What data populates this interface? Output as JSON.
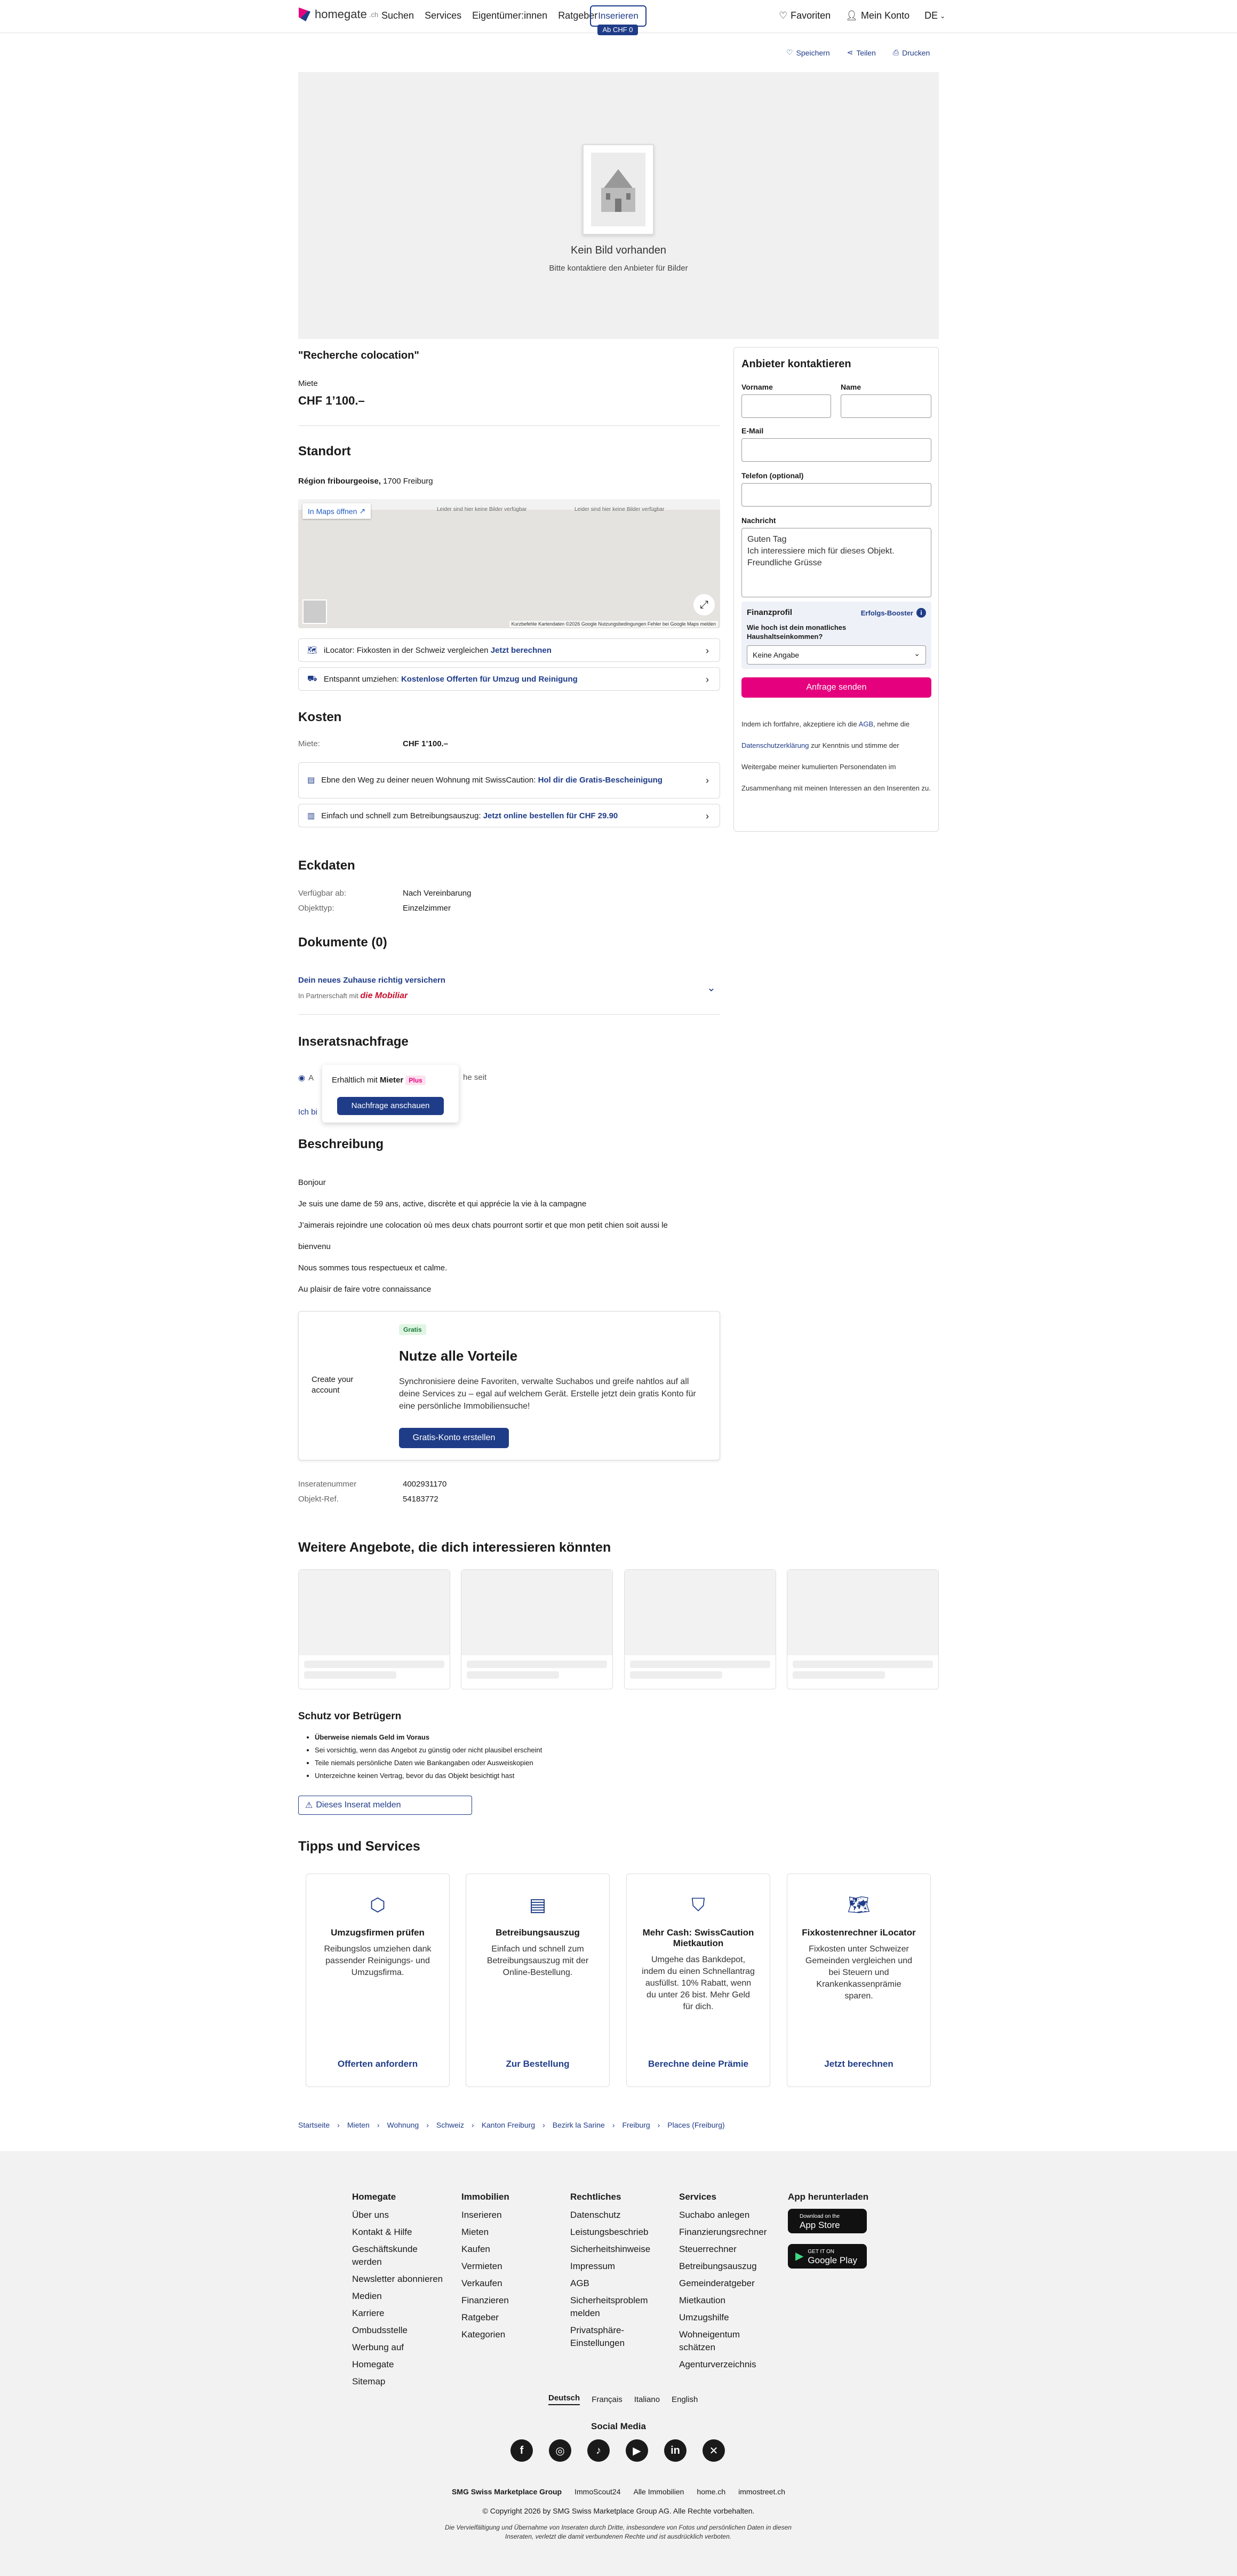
{
  "header": {
    "logo_text": "homegate",
    "logo_ch": ".ch",
    "nav": [
      "Suchen",
      "Services",
      "Eigentümer:innen",
      "Ratgeber"
    ],
    "insert_label": "Inserieren",
    "insert_badge": "Ab CHF 0",
    "favorites": "Favoriten",
    "account": "Mein Konto",
    "language": "DE"
  },
  "actions": {
    "save": "Speichern",
    "share": "Teilen",
    "print": "Drucken"
  },
  "hero": {
    "no_image": "Kein Bild vorhanden",
    "contact_hint": "Bitte kontaktiere den Anbieter für Bilder"
  },
  "listing": {
    "title": "\"Recherche colocation\"",
    "rent_label": "Miete",
    "rent_value": "CHF 1’100.–"
  },
  "location": {
    "heading": "Standort",
    "address_bold": "Région fribourgeoise,",
    "address_rest": " 1700 Freiburg",
    "map_open": "In Maps öffnen",
    "map_footer": "Kurzbefehle    Kartendaten ©2026 Google    Nutzungsbedingungen    Fehler bei Google Maps melden",
    "map_tile_text": "Leider sind hier keine Bilder verfügbar"
  },
  "links": {
    "ilocator_text": "iLocator: Fixkosten in der Schweiz vergleichen ",
    "ilocator_link": "Jetzt berechnen",
    "move_text": "Entspannt umziehen: ",
    "move_link": "Kostenlose Offerten für Umzug und Reinigung"
  },
  "costs": {
    "heading": "Kosten",
    "rent_label": "Miete:",
    "rent_value": "CHF 1’100.–",
    "caution_text": "Ebne den Weg zu deiner neuen Wohnung mit SwissCaution: ",
    "caution_link": "Hol dir die Gratis-Bescheinigung",
    "debt_text": "Einfach und schnell zum Betreibungsauszug: ",
    "debt_link": "Jetzt online bestellen für CHF 29.90"
  },
  "key_data": {
    "heading": "Eckdaten",
    "rows": [
      {
        "label": "Verfügbar ab:",
        "value": "Nach Vereinbarung"
      },
      {
        "label": "Objekttyp:",
        "value": "Einzelzimmer"
      }
    ]
  },
  "documents": {
    "heading": "Dokumente (0)",
    "insure_link": "Dein neues Zuhause richtig versichern",
    "partner": "In Partnerschaft mit",
    "partner_brand": "die Mobiliar"
  },
  "demand": {
    "heading": "Inseratsnachfrage",
    "row_prefix": "A",
    "row_suffix": "he seit",
    "more_prefix": "Ich bi",
    "popup_text": "Erhältlich mit ",
    "popup_brand": "Mieter",
    "popup_plus": "Plus",
    "popup_button": "Nachfrage anschauen"
  },
  "description": {
    "heading": "Beschreibung",
    "lines": [
      "Bonjour",
      "Je suis une dame de 59 ans, active, discrète et qui apprécie la vie à la campagne",
      "J’aimerais rejoindre une colocation où mes deux chats pourront sortir et que mon petit chien soit aussi le",
      "bienvenu",
      "Nous sommes tous respectueux et calme.",
      "Au plaisir de faire votre connaissance"
    ]
  },
  "promo": {
    "side_text": "Create your account",
    "badge": "Gratis",
    "title": "Nutze alle Vorteile",
    "text": "Synchronisiere deine Favoriten, verwalte Suchabos und greife nahtlos auf all deine Services zu – egal auf welchem Gerät. Erstelle jetzt dein gratis Konto für eine persönliche Immobiliensuche!",
    "button": "Gratis-Konto erstellen"
  },
  "ids": [
    {
      "label": "Inseratenummer",
      "value": "4002931170"
    },
    {
      "label": "Objekt-Ref.",
      "value": "54183772"
    }
  ],
  "more_offers": {
    "heading": "Weitere Angebote, die dich interessieren könnten"
  },
  "fraud": {
    "heading": "Schutz vor Betrügern",
    "bullets": [
      "Überweise niemals Geld im Voraus",
      "Sei vorsichtig, wenn das Angebot zu günstig oder nicht plausibel erscheint",
      "Teile niemals persönliche Daten wie Bankangaben oder Ausweiskopien",
      "Unterzeichne keinen Vertrag, bevor du das Objekt besichtigt hast"
    ],
    "report": "Dieses Inserat melden"
  },
  "tips": {
    "heading": "Tipps und Services",
    "cards": [
      {
        "icon": "box-icon",
        "title": "Umzugsfirmen prüfen",
        "text": "Reibungslos umziehen dank passender Reinigungs- und Umzugsfirma.",
        "link": "Offerten anfordern"
      },
      {
        "icon": "document-icon",
        "title": "Betreibungsauszug",
        "text": "Einfach und schnell zum Betreibungsauszug mit der Online-Bestellung.",
        "link": "Zur Bestellung"
      },
      {
        "icon": "shield-icon",
        "title": "Mehr Cash: SwissCaution Mietkaution",
        "text": "Umgehe das Bankdepot, indem du einen Schnellantrag ausfüllst. 10% Rabatt, wenn du unter 26 bist. Mehr Geld für dich.",
        "link": "Berechne deine Prämie"
      },
      {
        "icon": "map-icon",
        "title": "Fixkostenrechner iLocator",
        "text": "Fixkosten unter Schweizer Gemeinden vergleichen und bei Steuern und Krankenkassenprämie sparen.",
        "link": "Jetzt berechnen"
      }
    ]
  },
  "breadcrumb": [
    "Startseite",
    "Mieten",
    "Wohnung",
    "Schweiz",
    "Kanton Freiburg",
    "Bezirk la Sarine",
    "Freiburg",
    "Places (Freiburg)"
  ],
  "contact": {
    "heading": "Anbieter kontaktieren",
    "firstname": "Vorname",
    "lastname": "Name",
    "email": "E-Mail",
    "phone": "Telefon (optional)",
    "message": "Nachricht",
    "message_value": "Guten Tag\nIch interessiere mich für dieses Objekt.\nFreundliche Grüsse",
    "finance_title": "Finanzprofil",
    "booster": "Erfolgs-Booster",
    "income_question": "Wie hoch ist dein monatliches Haushaltseinkommen?",
    "income_value": "Keine Angabe",
    "send": "Anfrage senden",
    "legal_1": "Indem ich fortfahre, akzeptiere ich die ",
    "legal_agb": "AGB",
    "legal_2": ", nehme die ",
    "legal_ds": "Datenschutzerklärung",
    "legal_3": " zur Kenntnis und stimme der Weitergabe meiner kumulierten Personendaten im Zusammenhang mit meinen Interessen an den Inserenten zu."
  },
  "footer": {
    "cols": [
      {
        "heading": "Homegate",
        "items": [
          "Über uns",
          "Kontakt & Hilfe",
          "Geschäftskunde werden",
          "Newsletter abonnieren",
          "Medien",
          "Karriere",
          "Ombudsstelle",
          "Werbung auf Homegate",
          "Sitemap"
        ]
      },
      {
        "heading": "Immobilien",
        "items": [
          "Inserieren",
          "Mieten",
          "Kaufen",
          "Vermieten",
          "Verkaufen",
          "Finanzieren",
          "Ratgeber",
          "Kategorien"
        ]
      },
      {
        "heading": "Rechtliches",
        "items": [
          "Datenschutz",
          "Leistungsbeschrieb",
          "Sicherheitshinweise",
          "Impressum",
          "AGB",
          "Sicherheitsproblem melden",
          "Privatsphäre-Einstellungen"
        ]
      },
      {
        "heading": "Services",
        "items": [
          "Suchabo anlegen",
          "Finanzierungsrechner",
          "Steuerrechner",
          "Betreibungsauszug",
          "Gemeinderatgeber",
          "Mietkaution",
          "Umzugshilfe",
          "Wohneigentum schätzen",
          "Agenturverzeichnis"
        ]
      }
    ],
    "app_heading": "App herunterladen",
    "app_store": "App Store",
    "app_store_small": "Download on the",
    "play_store": "Google Play",
    "play_store_small": "GET IT ON",
    "languages": [
      "Deutsch",
      "Français",
      "Italiano",
      "English"
    ],
    "social_heading": "Social Media",
    "group": [
      "SMG Swiss Marketplace Group",
      "ImmoScout24",
      "Alle Immobilien",
      "home.ch",
      "immostreet.ch"
    ],
    "copyright": "© Copyright 2026 by SMG Swiss Marketplace Group AG. Alle Rechte vorbehalten.",
    "disclaimer": "Die Vervielfältigung und Übernahme von Inseraten durch Dritte, insbesondere von Fotos und persönlichen Daten in diesen Inseraten, verletzt die damit verbundenen Rechte und ist ausdrücklich verboten."
  }
}
